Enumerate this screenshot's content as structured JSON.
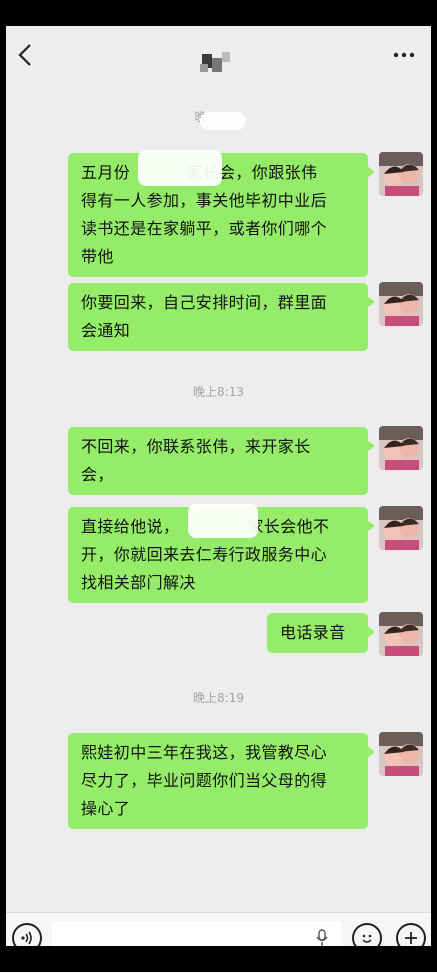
{
  "header": {
    "back_icon": "chevron-left-icon",
    "more_icon": "more-horizontal-icon"
  },
  "timestamps": {
    "t1": "晚",
    "t2": "晚上8:13",
    "t3": "晚上8:19"
  },
  "messages": [
    {
      "lines": [
        "五月份",
        "家长会，你跟张伟",
        "得有一人参加，事关他毕初中业后",
        "读书还是在家躺平，或者你们哪个",
        "带他"
      ]
    },
    {
      "lines": [
        "你要回来，自己安排时间，群里面",
        "会通知"
      ]
    },
    {
      "lines": [
        "不回来，你联系张伟，来开家长",
        "会，"
      ]
    },
    {
      "lines": [
        "直接给他说，",
        "家长会他不",
        "开，你就回来去仁寿行政服务中心",
        "找相关部门解决"
      ]
    },
    {
      "lines": [
        "电话录音"
      ]
    },
    {
      "lines": [
        "熙娃初中三年在我这，我管教尽心",
        "尽力了，毕业问题你们当父母的得",
        "操心了"
      ]
    }
  ],
  "input_bar": {
    "voice_icon": "voice-icon",
    "mic_icon": "microphone-icon",
    "emoji_icon": "emoji-icon",
    "plus_icon": "plus-icon"
  },
  "colors": {
    "bubble": "#95ec69",
    "background": "#ededed"
  }
}
